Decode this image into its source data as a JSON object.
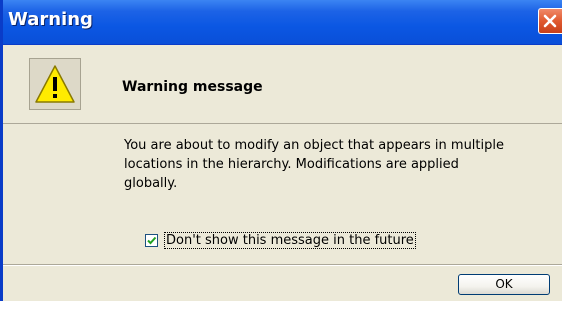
{
  "window": {
    "title": "Warning",
    "close_icon": "close-icon"
  },
  "header": {
    "icon": "warning-icon",
    "heading": "Warning message"
  },
  "body": {
    "message_line1": "You are about to modify an object that appears in multiple",
    "message_line2": "locations in the hierarchy. Modifications are applied",
    "message_line3": "globally."
  },
  "checkbox": {
    "checked": true,
    "label": "Don't show this message in the future"
  },
  "buttons": {
    "ok_label": "OK"
  },
  "colors": {
    "titlebar": "#0b57e3",
    "close_button": "#e05a30",
    "dialog_background": "#ece9d8",
    "warning_yellow": "#ffeb00"
  }
}
